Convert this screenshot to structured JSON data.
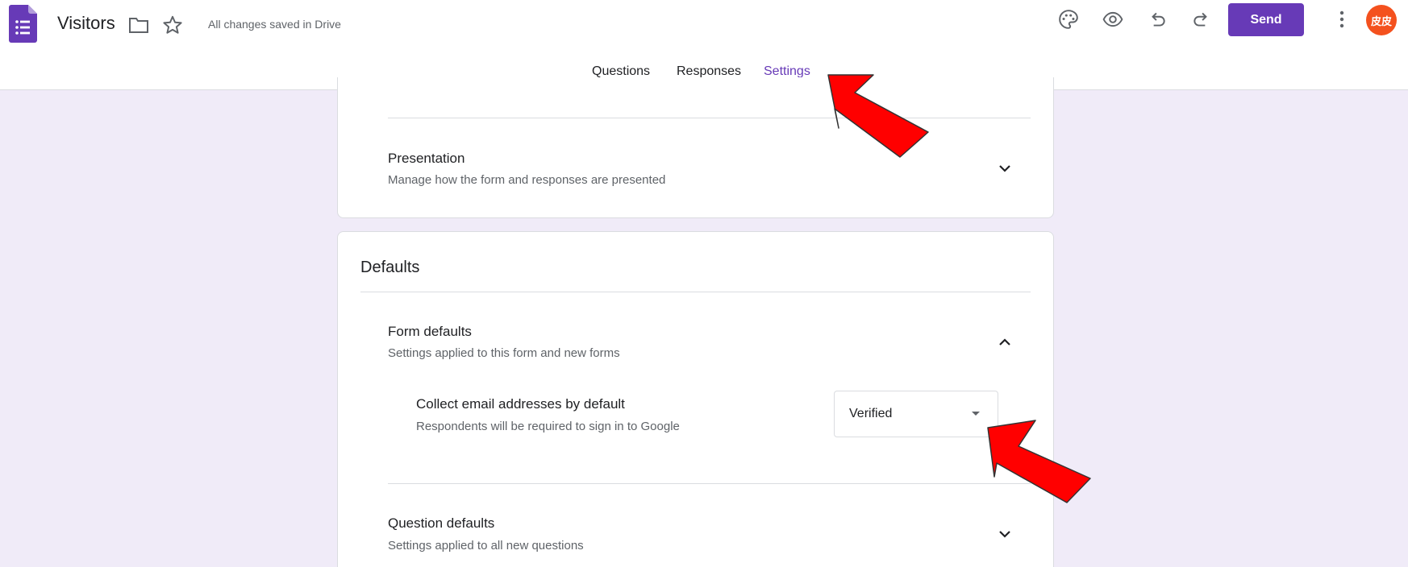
{
  "header": {
    "title": "Visitors",
    "saved_status": "All changes saved in Drive",
    "send_label": "Send",
    "avatar_text": "皮皮",
    "icons": [
      "forms-logo-icon",
      "folder-icon",
      "star-icon",
      "palette-icon",
      "eye-icon",
      "undo-icon",
      "redo-icon",
      "more-vert-icon"
    ]
  },
  "tabs": [
    {
      "label": "Questions"
    },
    {
      "label": "Responses"
    },
    {
      "label": "Settings",
      "active": true
    }
  ],
  "presentation": {
    "title": "Presentation",
    "subtitle": "Manage how the form and responses are presented"
  },
  "defaults": {
    "title": "Defaults",
    "form_defaults": {
      "title": "Form defaults",
      "subtitle": "Settings applied to this form and new forms",
      "collect_email": {
        "title": "Collect email addresses by default",
        "subtitle": "Respondents will be required to sign in to Google",
        "selected": "Verified"
      }
    },
    "question_defaults": {
      "title": "Question defaults",
      "subtitle": "Settings applied to all new questions"
    }
  },
  "colors": {
    "accent": "#673ab7",
    "background": "#f0ebf8",
    "annotation_arrow": "#ff0000"
  }
}
